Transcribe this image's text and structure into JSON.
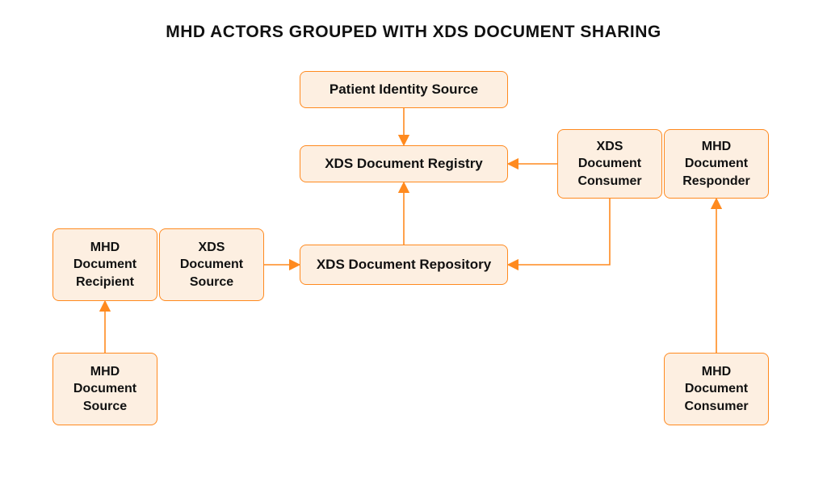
{
  "title": "MHD ACTORS GROUPED WITH XDS DOCUMENT SHARING",
  "nodes": {
    "patient_identity_source": "Patient Identity Source",
    "xds_document_registry": "XDS Document Registry",
    "xds_document_repository": "XDS Document Repository",
    "xds_document_consumer": "XDS Document Consumer",
    "mhd_document_responder": "MHD Document Responder",
    "mhd_document_recipient": "MHD Document Recipient",
    "xds_document_source": "XDS Document Source",
    "mhd_document_source": "MHD Document Source",
    "mhd_document_consumer": "MHD Document Consumer"
  },
  "connections": [
    {
      "from": "patient_identity_source",
      "to": "xds_document_registry"
    },
    {
      "from": "xds_document_repository",
      "to": "xds_document_registry"
    },
    {
      "from": "xds_document_source",
      "to": "xds_document_repository"
    },
    {
      "from": "mhd_document_source",
      "to": "mhd_document_recipient"
    },
    {
      "from": "xds_document_consumer",
      "to": "xds_document_registry"
    },
    {
      "from": "xds_document_consumer",
      "to": "xds_document_repository"
    },
    {
      "from": "mhd_document_consumer",
      "to": "mhd_document_responder"
    }
  ],
  "groupings": [
    [
      "mhd_document_recipient",
      "xds_document_source"
    ],
    [
      "xds_document_consumer",
      "mhd_document_responder"
    ]
  ],
  "colors": {
    "node_border": "#ff8a1f",
    "node_fill": "#fdefe1",
    "arrow": "#ff8a1f"
  }
}
